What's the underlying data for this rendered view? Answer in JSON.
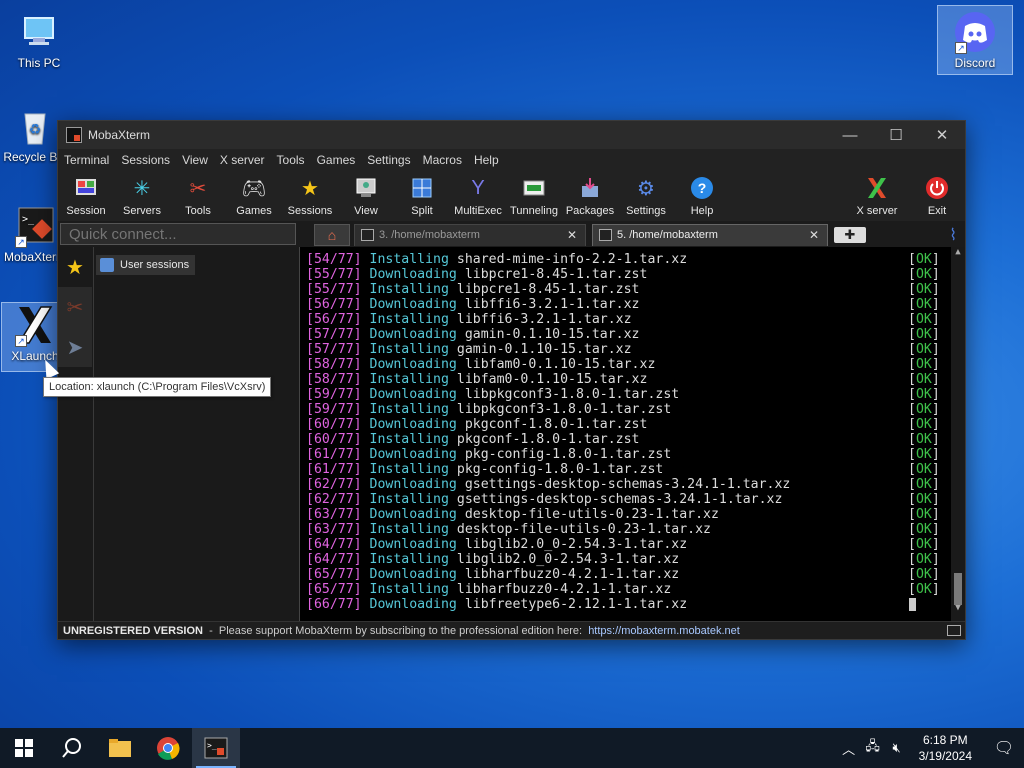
{
  "desktop": {
    "icons": [
      {
        "label": "This PC"
      },
      {
        "label": "Recycle Bin"
      },
      {
        "label": "MobaXterm"
      },
      {
        "label": "XLaunch"
      },
      {
        "label": "Discord"
      }
    ]
  },
  "window": {
    "title": "MobaXterm",
    "menu": [
      "Terminal",
      "Sessions",
      "View",
      "X server",
      "Tools",
      "Games",
      "Settings",
      "Macros",
      "Help"
    ],
    "toolbar": [
      "Session",
      "Servers",
      "Tools",
      "Games",
      "Sessions",
      "View",
      "Split",
      "MultiExec",
      "Tunneling",
      "Packages",
      "Settings",
      "Help"
    ],
    "toolbar_right": [
      "X server",
      "Exit"
    ],
    "quick_connect_placeholder": "Quick connect...",
    "tabs": [
      {
        "label": "3. /home/mobaxterm",
        "active": false
      },
      {
        "label": "5. /home/mobaxterm",
        "active": true
      }
    ],
    "sidebar": {
      "user_sessions": "User sessions"
    },
    "terminal_lines": [
      {
        "idx": "[54/77]",
        "action": "Installing",
        "pkg": "shared-mime-info-2.2-1.tar.xz",
        "status": "OK"
      },
      {
        "idx": "[55/77]",
        "action": "Downloading",
        "pkg": "libpcre1-8.45-1.tar.zst",
        "status": "OK"
      },
      {
        "idx": "[55/77]",
        "action": "Installing",
        "pkg": "libpcre1-8.45-1.tar.zst",
        "status": "OK"
      },
      {
        "idx": "[56/77]",
        "action": "Downloading",
        "pkg": "libffi6-3.2.1-1.tar.xz",
        "status": "OK"
      },
      {
        "idx": "[56/77]",
        "action": "Installing",
        "pkg": "libffi6-3.2.1-1.tar.xz",
        "status": "OK"
      },
      {
        "idx": "[57/77]",
        "action": "Downloading",
        "pkg": "gamin-0.1.10-15.tar.xz",
        "status": "OK"
      },
      {
        "idx": "[57/77]",
        "action": "Installing",
        "pkg": "gamin-0.1.10-15.tar.xz",
        "status": "OK"
      },
      {
        "idx": "[58/77]",
        "action": "Downloading",
        "pkg": "libfam0-0.1.10-15.tar.xz",
        "status": "OK"
      },
      {
        "idx": "[58/77]",
        "action": "Installing",
        "pkg": "libfam0-0.1.10-15.tar.xz",
        "status": "OK"
      },
      {
        "idx": "[59/77]",
        "action": "Downloading",
        "pkg": "libpkgconf3-1.8.0-1.tar.zst",
        "status": "OK"
      },
      {
        "idx": "[59/77]",
        "action": "Installing",
        "pkg": "libpkgconf3-1.8.0-1.tar.zst",
        "status": "OK"
      },
      {
        "idx": "[60/77]",
        "action": "Downloading",
        "pkg": "pkgconf-1.8.0-1.tar.zst",
        "status": "OK"
      },
      {
        "idx": "[60/77]",
        "action": "Installing",
        "pkg": "pkgconf-1.8.0-1.tar.zst",
        "status": "OK"
      },
      {
        "idx": "[61/77]",
        "action": "Downloading",
        "pkg": "pkg-config-1.8.0-1.tar.zst",
        "status": "OK"
      },
      {
        "idx": "[61/77]",
        "action": "Installing",
        "pkg": "pkg-config-1.8.0-1.tar.zst",
        "status": "OK"
      },
      {
        "idx": "[62/77]",
        "action": "Downloading",
        "pkg": "gsettings-desktop-schemas-3.24.1-1.tar.xz",
        "status": "OK"
      },
      {
        "idx": "[62/77]",
        "action": "Installing",
        "pkg": "gsettings-desktop-schemas-3.24.1-1.tar.xz",
        "status": "OK"
      },
      {
        "idx": "[63/77]",
        "action": "Downloading",
        "pkg": "desktop-file-utils-0.23-1.tar.xz",
        "status": "OK"
      },
      {
        "idx": "[63/77]",
        "action": "Installing",
        "pkg": "desktop-file-utils-0.23-1.tar.xz",
        "status": "OK"
      },
      {
        "idx": "[64/77]",
        "action": "Downloading",
        "pkg": "libglib2.0_0-2.54.3-1.tar.xz",
        "status": "OK"
      },
      {
        "idx": "[64/77]",
        "action": "Installing",
        "pkg": "libglib2.0_0-2.54.3-1.tar.xz",
        "status": "OK"
      },
      {
        "idx": "[65/77]",
        "action": "Downloading",
        "pkg": "libharfbuzz0-4.2.1-1.tar.xz",
        "status": "OK"
      },
      {
        "idx": "[65/77]",
        "action": "Installing",
        "pkg": "libharfbuzz0-4.2.1-1.tar.xz",
        "status": "OK"
      },
      {
        "idx": "[66/77]",
        "action": "Downloading",
        "pkg": "libfreetype6-2.12.1-1.tar.xz",
        "status": ""
      }
    ],
    "status": {
      "bold": "UNREGISTERED VERSION",
      "text": "  -  Please support MobaXterm by subscribing to the professional edition here:  ",
      "link": "https://mobaxterm.mobatek.net"
    }
  },
  "tooltip": "Location: xlaunch (C:\\Program Files\\VcXsrv)",
  "taskbar": {
    "time": "6:18 PM",
    "date": "3/19/2024"
  },
  "colors": {
    "idx": "#e064e0",
    "action": "#56c8d8",
    "ok": "#3ec24a"
  }
}
